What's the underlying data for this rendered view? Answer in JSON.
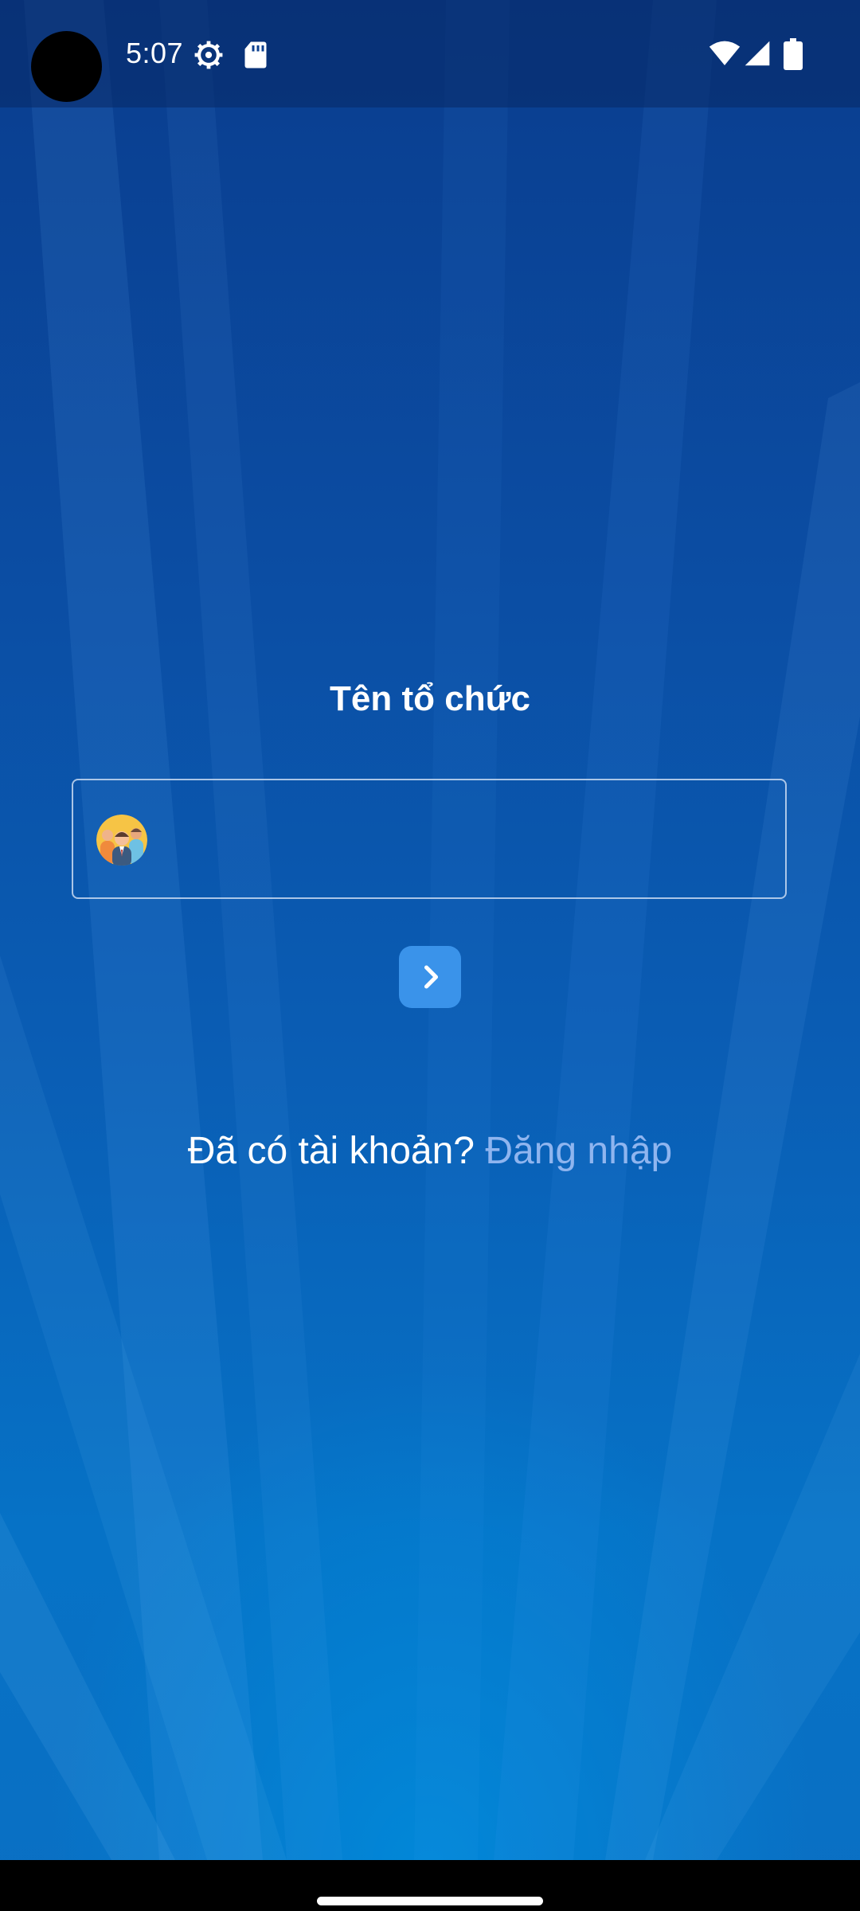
{
  "status_bar": {
    "time": "5:07",
    "icons": [
      "settings-gear-icon",
      "sd-card-icon",
      "wifi-icon",
      "cell-signal-icon",
      "battery-icon"
    ]
  },
  "form": {
    "title": "Tên tổ chức",
    "org_input": {
      "value": "",
      "placeholder": "",
      "icon": "people-avatar-icon"
    },
    "next_icon": "chevron-right-icon"
  },
  "footer": {
    "question": "Đã có tài khoản?",
    "login_link": "Đăng nhập"
  },
  "colors": {
    "background_top": "#0a3d8e",
    "background_bottom": "#0672c6",
    "next_button": "#3a93ea",
    "link": "#8fb5ef"
  }
}
